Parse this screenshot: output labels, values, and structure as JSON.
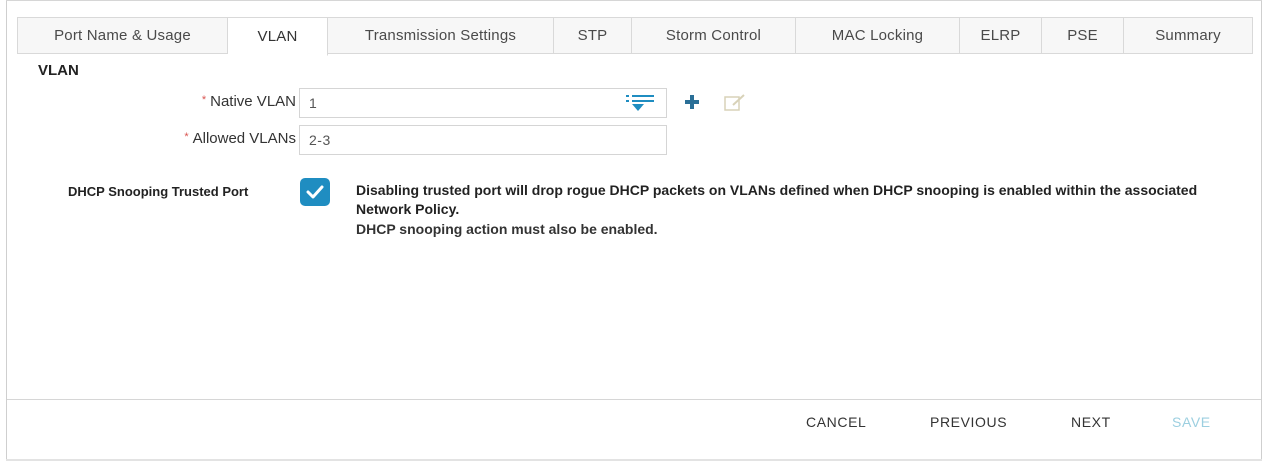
{
  "tabs": [
    {
      "label": "Port Name & Usage"
    },
    {
      "label": "VLAN"
    },
    {
      "label": "Transmission Settings"
    },
    {
      "label": "STP"
    },
    {
      "label": "Storm Control"
    },
    {
      "label": "MAC Locking"
    },
    {
      "label": "ELRP"
    },
    {
      "label": "PSE"
    },
    {
      "label": "Summary"
    }
  ],
  "active_tab": "VLAN",
  "section": {
    "title": "VLAN"
  },
  "form": {
    "native_vlan": {
      "required_mark": "*",
      "label": "Native VLAN",
      "value": "1"
    },
    "allowed_vlans": {
      "required_mark": "*",
      "label": "Allowed VLANs",
      "value": "2-3"
    },
    "icons": {
      "list": "vlan-list-icon",
      "add": "plus-icon",
      "edit": "edit-icon"
    }
  },
  "dhcp": {
    "label": "DHCP Snooping Trusted Port",
    "checked": true,
    "note": "Disabling trusted port will drop rogue DHCP packets on VLANs defined when DHCP snooping is enabled within the associated Network Policy.",
    "note_sub": "DHCP snooping action must also be enabled."
  },
  "footer": {
    "cancel": "CANCEL",
    "previous": "PREVIOUS",
    "next": "NEXT",
    "save": "SAVE"
  },
  "colors": {
    "accent": "#1f8dc1",
    "required": "#d9534f",
    "disabled": "#9ccfe0"
  }
}
